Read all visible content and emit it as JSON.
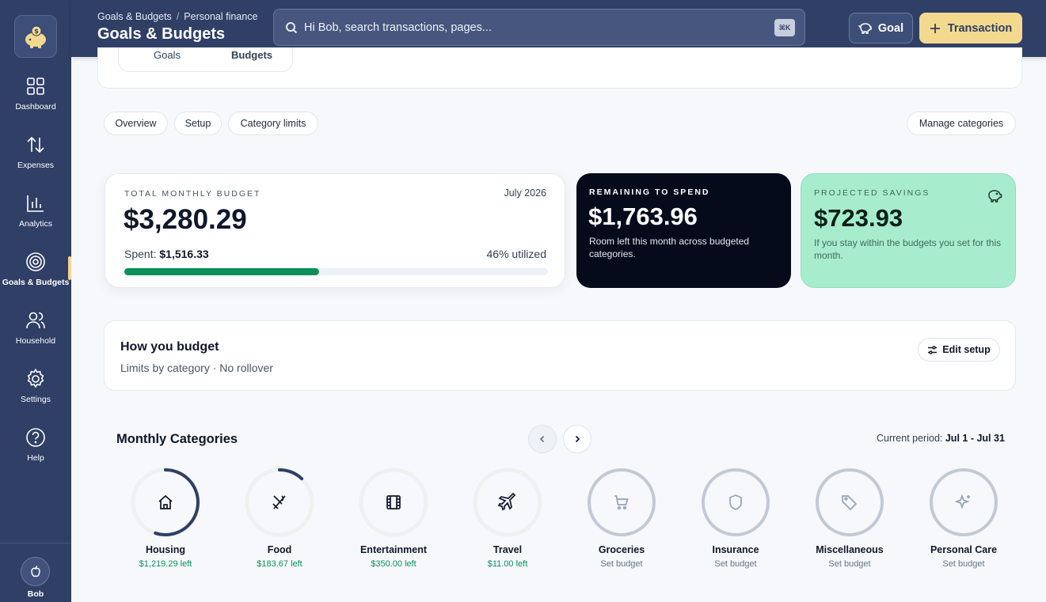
{
  "sidebar": {
    "items": [
      {
        "label": "Dashboard",
        "icon": "grid-icon"
      },
      {
        "label": "Expenses",
        "icon": "arrows-up-down-icon"
      },
      {
        "label": "Analytics",
        "icon": "bar-chart-icon"
      },
      {
        "label": "Goals & Budgets",
        "icon": "target-icon",
        "active": true
      },
      {
        "label": "Household",
        "icon": "users-icon"
      },
      {
        "label": "Settings",
        "icon": "gear-icon"
      },
      {
        "label": "Help",
        "icon": "help-circle-icon"
      }
    ],
    "user": "Bob"
  },
  "header": {
    "breadcrumb_parent": "Goals & Budgets",
    "breadcrumb_current": "Personal finance",
    "title": "Goals & Budgets",
    "search_placeholder": "Hi Bob, search transactions, pages...",
    "search_shortcut": "⌘K",
    "goal_label": "Goal",
    "transaction_label": "Transaction"
  },
  "segment": {
    "goals": "Goals",
    "budgets": "Budgets"
  },
  "tabs": [
    "Overview",
    "Setup",
    "Category limits"
  ],
  "manage_categories": "Manage categories",
  "total": {
    "eyebrow": "TOTAL MONTHLY BUDGET",
    "month": "July 2026",
    "amount": "$3,280.29",
    "spent_label": "Spent:",
    "spent_value": "$1,516.33",
    "utilized": "46% utilized",
    "utilized_fraction": 0.46
  },
  "remaining": {
    "eyebrow": "REMAINING TO SPEND",
    "amount": "$1,763.96",
    "desc": "Room left this month across budgeted categories."
  },
  "savings": {
    "eyebrow": "PROJECTED SAVINGS",
    "amount": "$723.93",
    "desc": "If you stay within the budgets you set for this month."
  },
  "how": {
    "title": "How you budget",
    "subtitle": "Limits by category · No rollover",
    "edit_label": "Edit setup"
  },
  "monthly": {
    "title": "Monthly Categories",
    "period_label": "Current period:",
    "period_value": "Jul 1 - Jul 31",
    "categories": [
      {
        "name": "Housing",
        "status": "$1,219.29 left",
        "progress": 0.55,
        "icon": "house-icon",
        "set": true
      },
      {
        "name": "Food",
        "status": "$183.67 left",
        "progress": 0.12,
        "icon": "utensils-icon",
        "set": true
      },
      {
        "name": "Entertainment",
        "status": "$350.00 left",
        "progress": 0,
        "icon": "film-icon",
        "set": true
      },
      {
        "name": "Travel",
        "status": "$11.00 left",
        "progress": 0,
        "icon": "plane-icon",
        "set": true
      },
      {
        "name": "Groceries",
        "status": "Set budget",
        "progress": 0,
        "icon": "cart-icon",
        "set": false
      },
      {
        "name": "Insurance",
        "status": "Set budget",
        "progress": 0,
        "icon": "shield-icon",
        "set": false
      },
      {
        "name": "Miscellaneous",
        "status": "Set budget",
        "progress": 0,
        "icon": "tag-icon",
        "set": false
      },
      {
        "name": "Personal Care",
        "status": "Set budget",
        "progress": 0,
        "icon": "sparkle-icon",
        "set": false
      }
    ]
  },
  "colors": {
    "navy": "#2f3f66",
    "accent": "#f3d98e",
    "green": "#0c8f5a",
    "dark": "#060b1c",
    "mint": "#a8ecce"
  }
}
